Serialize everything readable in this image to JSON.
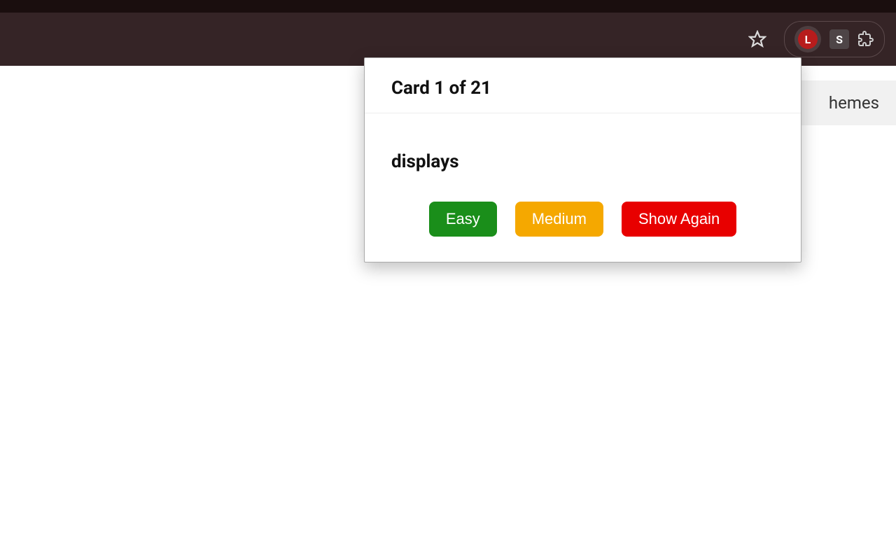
{
  "page": {
    "themes_tab": "hemes"
  },
  "toolbar": {
    "ext_l_label": "L",
    "ext_s_label": "S"
  },
  "popup": {
    "header": "Card 1 of 21",
    "term": "displays",
    "buttons": {
      "easy": "Easy",
      "medium": "Medium",
      "show_again": "Show Again"
    }
  }
}
